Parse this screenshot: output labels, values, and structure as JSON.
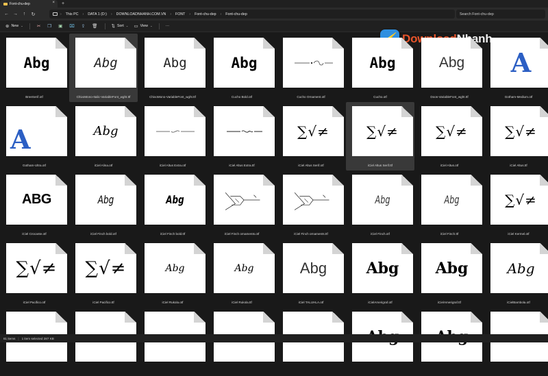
{
  "window": {
    "tab_title": "Font-chu-dep",
    "tab_close_icon": "close-icon",
    "new_tab_icon": "plus-icon"
  },
  "address": {
    "breadcrumb": [
      "This PC",
      "DATA 1 (D:)",
      "DOWNLOADNHANH.COM.VN",
      "FONT",
      "Font-chu-dep",
      "Font-chu-dep"
    ],
    "search_placeholder": "Search Font-chu-dep"
  },
  "commands": {
    "new_label": "New",
    "sort_label": "Sort",
    "view_label": "View",
    "more_label": "···"
  },
  "watermark": {
    "part1": "Download",
    "part2": "Nhanh"
  },
  "files": [
    {
      "name": "BreeSerif.otf",
      "sample": "Abg",
      "style": "s-bree"
    },
    {
      "name": "ChivoMono-Italic-VariableFont_wght.ttf",
      "sample": "Abg",
      "style": "s-chivoit",
      "selected": true
    },
    {
      "name": "ChivoMono-VariableFont_wght.ttf",
      "sample": "Abg",
      "style": "s-chivo"
    },
    {
      "name": "Cucho Bold.otf",
      "sample": "Abg",
      "style": "s-cucho"
    },
    {
      "name": "Cucho Ornament.otf",
      "sample": "",
      "style": "ornament1"
    },
    {
      "name": "Cucho.otf",
      "sample": "Abg",
      "style": "s-cucho"
    },
    {
      "name": "Doos-VariableFont_wght.ttf",
      "sample": "Abg",
      "style": "s-doos"
    },
    {
      "name": "Gotham-Medium.otf",
      "sample": "A",
      "style": "s-gotham"
    },
    {
      "name": "Gotham-Ultra.otf",
      "sample": "A",
      "style": "s-gotham ultra"
    },
    {
      "name": "iCiel Alina.otf",
      "sample": "Abg",
      "style": "s-script"
    },
    {
      "name": "iCiel Altus Extra.otf",
      "sample": "",
      "style": "ornament2"
    },
    {
      "name": "iCiel Altus Extra.ttf",
      "sample": "",
      "style": "ornament3"
    },
    {
      "name": "iCiel Altus Serif.otf",
      "sample": "∑√≠",
      "style": "s-math"
    },
    {
      "name": "iCiel Altus Serif.ttf",
      "sample": "∑√≠",
      "style": "s-math",
      "selected": true
    },
    {
      "name": "iCiel Altus.otf",
      "sample": "∑√≠",
      "style": "s-math"
    },
    {
      "name": "iCiel Altus.ttf",
      "sample": "∑√≠",
      "style": "s-math"
    },
    {
      "name": "iCiel Crocante.otf",
      "sample": "ABG",
      "style": "s-crocante"
    },
    {
      "name": "iCiel Finch bold.otf",
      "sample": "Abg",
      "style": "s-finch"
    },
    {
      "name": "iCiel Finch bold.ttf",
      "sample": "Abg",
      "style": "s-finchb"
    },
    {
      "name": "iCiel Finch ornaments.otf",
      "sample": "",
      "style": "ornament4"
    },
    {
      "name": "iCiel Finch ornaments.ttf",
      "sample": "",
      "style": "ornament4"
    },
    {
      "name": "iCiel Finch.otf",
      "sample": "Abg",
      "style": "s-finchlight"
    },
    {
      "name": "iCiel Finch.ttf",
      "sample": "Abg",
      "style": "s-finchlight"
    },
    {
      "name": "iCiel Kermel.otf",
      "sample": "∑√≠",
      "style": "s-math"
    },
    {
      "name": "iCiel Pacifico.otf",
      "sample": "∑√≠",
      "style": "s-math big"
    },
    {
      "name": "iCiel Pacifico.ttf",
      "sample": "∑√≠",
      "style": "s-math big"
    },
    {
      "name": "iCiel Rukola.otf",
      "sample": "Abg",
      "style": "s-script small"
    },
    {
      "name": "iCiel Rukola.ttf",
      "sample": "Abg",
      "style": "s-script small"
    },
    {
      "name": "iCiel TALUHLA.otf",
      "sample": "Abg",
      "style": "s-talu"
    },
    {
      "name": "iCielAmerigraf.otf",
      "sample": "Abg",
      "style": "s-amer"
    },
    {
      "name": "iCielAmerigraf.ttf",
      "sample": "Abg",
      "style": "s-amer"
    },
    {
      "name": "iCielBambola.otf",
      "sample": "Abg",
      "style": "s-bamb"
    },
    {
      "name": "",
      "sample": "",
      "style": "blank"
    },
    {
      "name": "",
      "sample": "",
      "style": "blank"
    },
    {
      "name": "",
      "sample": "",
      "style": "blank"
    },
    {
      "name": "",
      "sample": "",
      "style": "blank"
    },
    {
      "name": "",
      "sample": "",
      "style": "blank"
    },
    {
      "name": "",
      "sample": "Abg",
      "style": "s-amer"
    },
    {
      "name": "",
      "sample": "Abg",
      "style": "s-amer"
    },
    {
      "name": "",
      "sample": "",
      "style": "blank"
    }
  ],
  "status": {
    "items_count": "81 items",
    "selected": "1 item selected  287 KB"
  }
}
